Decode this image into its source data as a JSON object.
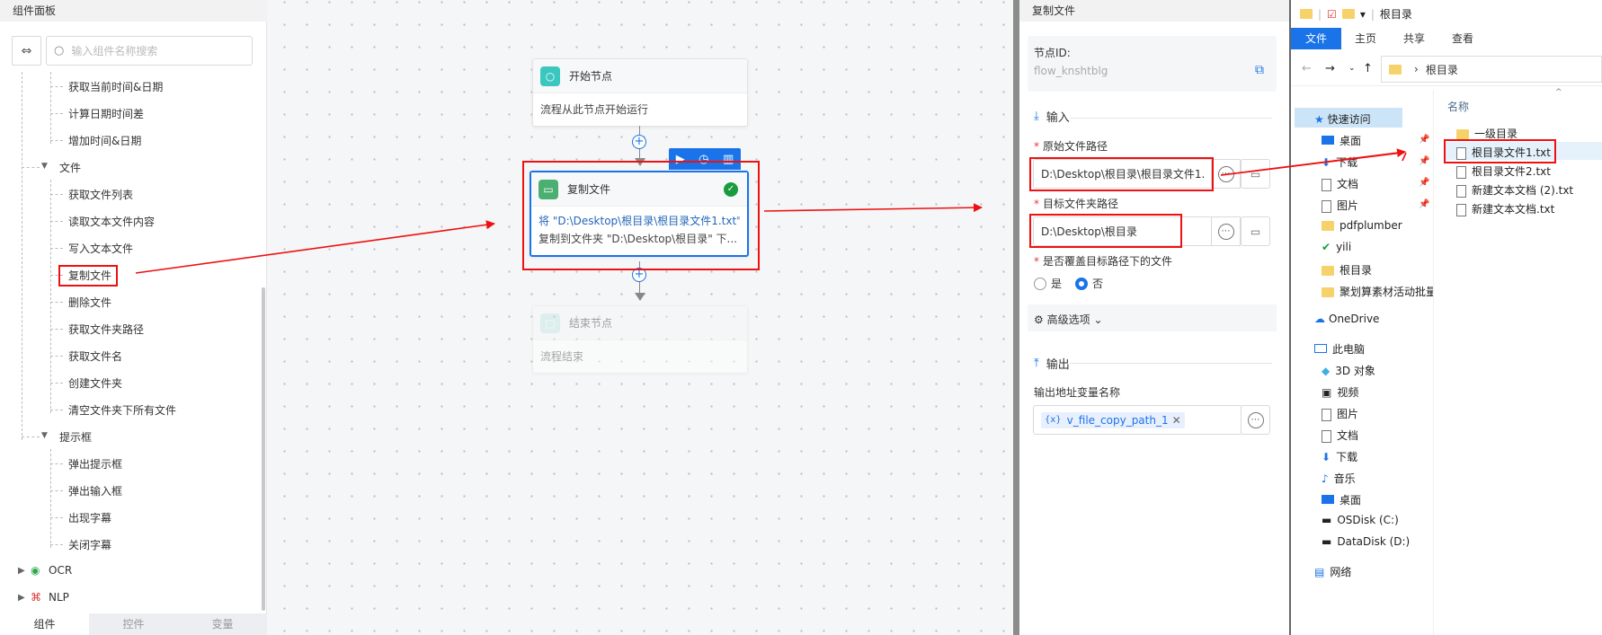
{
  "left_panel": {
    "title": "组件面板",
    "search_placeholder": "输入组件名称搜索",
    "items_datetime": [
      "获取当前时间&日期",
      "计算日期时间差",
      "增加时间&日期"
    ],
    "group_file": "文件",
    "items_file": [
      "获取文件列表",
      "读取文本文件内容",
      "写入文本文件",
      "复制文件",
      "删除文件",
      "获取文件夹路径",
      "获取文件名",
      "创建文件夹",
      "清空文件夹下所有文件"
    ],
    "group_dialog": "提示框",
    "items_dialog": [
      "弹出提示框",
      "弹出输入框",
      "出现字幕",
      "关闭字幕"
    ],
    "group_ocr": "OCR",
    "group_nlp": "NLP",
    "tabs": [
      "组件",
      "控件",
      "变量"
    ]
  },
  "canvas": {
    "start_node": {
      "title": "开始节点",
      "desc": "流程从此节点开始运行"
    },
    "copy_node": {
      "title": "复制文件",
      "line1": "将 \"D:\\Desktop\\根目录\\根目录文件1.txt\"",
      "line2": "复制到文件夹 \"D:\\Desktop\\根目录\" 下..."
    },
    "end_node": {
      "title": "结束节点",
      "desc": "流程结束"
    }
  },
  "properties": {
    "title": "复制文件",
    "node_id_label": "节点ID:",
    "node_id_value": "flow_knshtblg",
    "input_section": "输入",
    "source_label": "原始文件路径",
    "source_value": "D:\\Desktop\\根目录\\根目录文件1.",
    "target_label": "目标文件夹路径",
    "target_value": "D:\\Desktop\\根目录",
    "overwrite_label": "是否覆盖目标路径下的文件",
    "opt_yes": "是",
    "opt_no": "否",
    "advanced": "高级选项",
    "output_section": "输出",
    "output_label": "输出地址变量名称",
    "output_var": "v_file_copy_path_1"
  },
  "explorer": {
    "title": "根目录",
    "ribbon_tabs": [
      "文件",
      "主页",
      "共享",
      "查看"
    ],
    "address": "根目录",
    "column_name": "名称",
    "nav_items": [
      "快速访问",
      "桌面",
      "下载",
      "文档",
      "图片",
      "pdfplumber",
      "yili",
      "根目录",
      "聚划算素材活动批量",
      "OneDrive",
      "此电脑",
      "3D 对象",
      "视频",
      "图片",
      "文档",
      "下载",
      "音乐",
      "桌面",
      "OSDisk (C:)",
      "DataDisk (D:)",
      "网络"
    ],
    "files": [
      "一级目录",
      "根目录文件1.txt",
      "根目录文件2.txt",
      "新建文本文档 (2).txt",
      "新建文本文档.txt"
    ]
  },
  "colors": {
    "accent": "#1a73e8",
    "annotation": "#e11111",
    "success": "#1a9c3e"
  }
}
